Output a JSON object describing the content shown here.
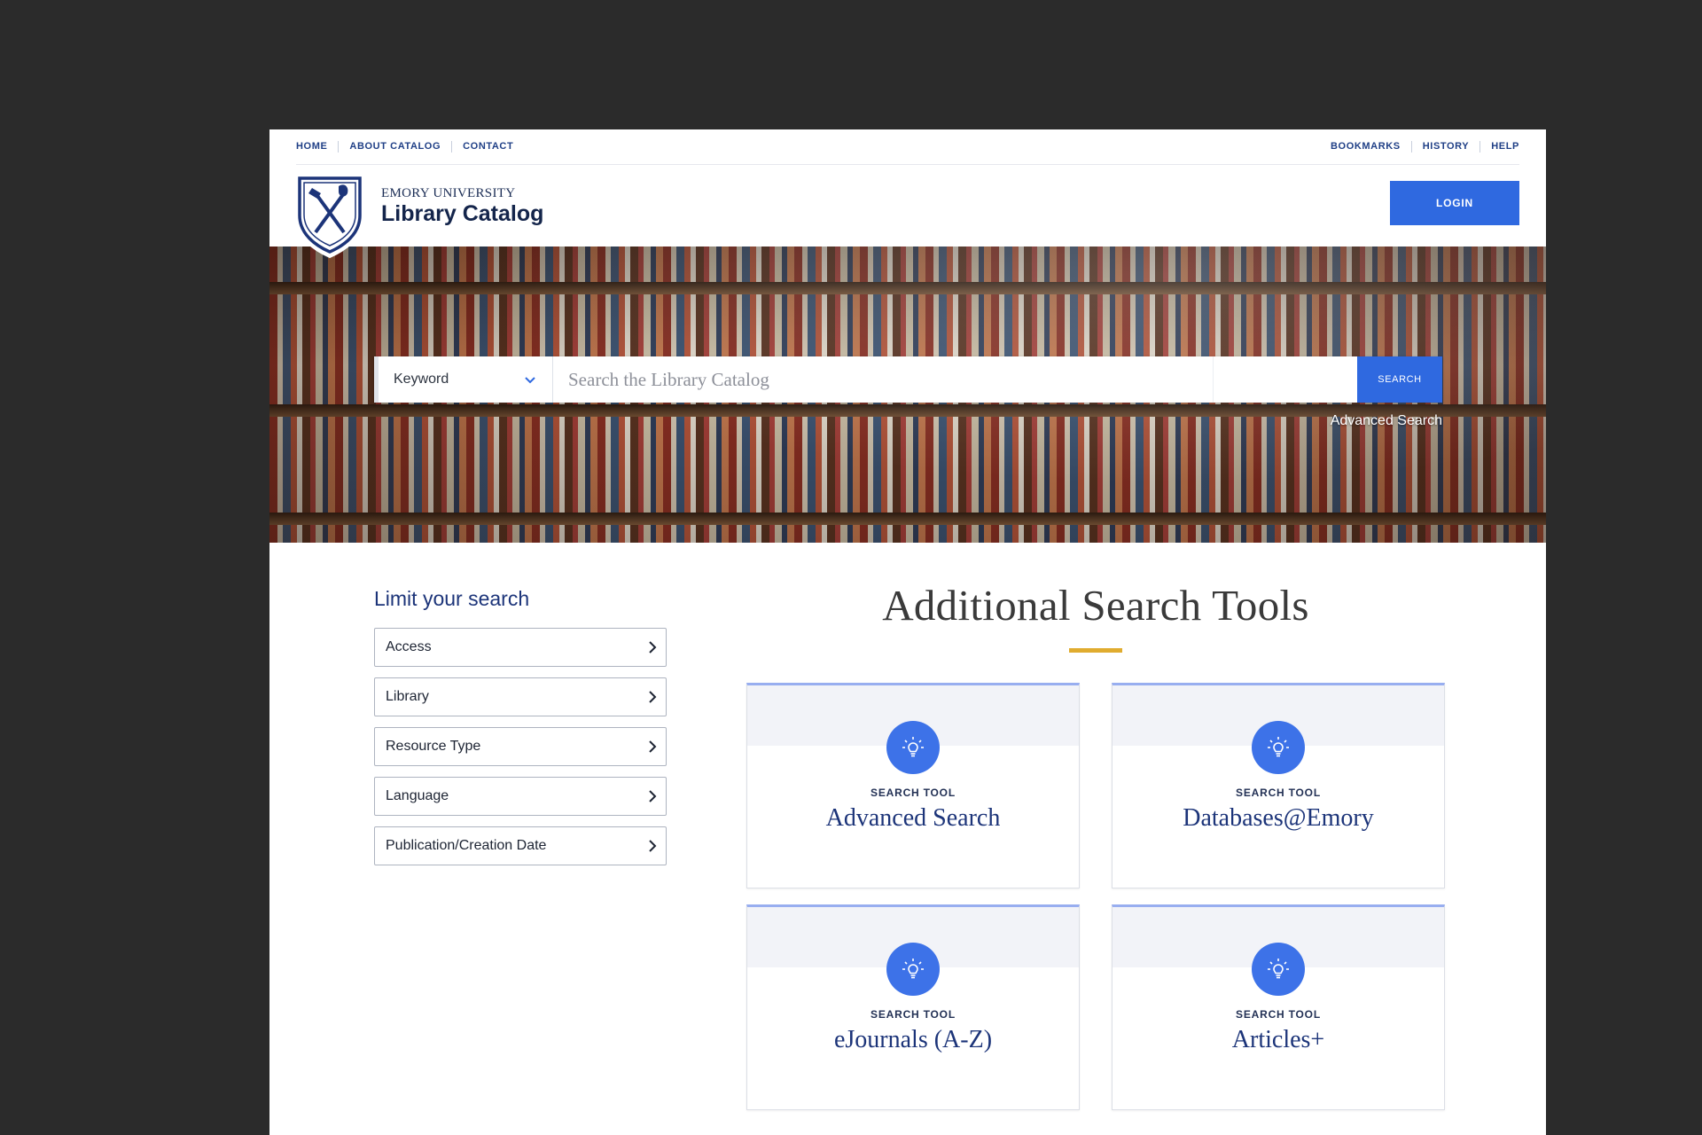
{
  "utility_nav": {
    "left": [
      "HOME",
      "ABOUT CATALOG",
      "CONTACT"
    ],
    "right": [
      "BOOKMARKS",
      "HISTORY",
      "HELP"
    ]
  },
  "header": {
    "brand_small": "EMORY UNIVERSITY",
    "brand_title": "Library Catalog",
    "login_label": "LOGIN",
    "logo_icon": "emory-shield-icon"
  },
  "search": {
    "field_selected": "Keyword",
    "placeholder": "Search the Library Catalog",
    "button_label": "SEARCH",
    "advanced_link": "Advanced Search"
  },
  "limit": {
    "title": "Limit your search",
    "facets": [
      "Access",
      "Library",
      "Resource Type",
      "Language",
      "Publication/Creation Date"
    ]
  },
  "tools": {
    "title": "Additional Search Tools",
    "cards": [
      {
        "kicker": "SEARCH TOOL",
        "name": "Advanced Search"
      },
      {
        "kicker": "SEARCH TOOL",
        "name": "Databases@Emory"
      },
      {
        "kicker": "SEARCH TOOL",
        "name": "eJournals (A-Z)"
      },
      {
        "kicker": "SEARCH TOOL",
        "name": "Articles+"
      }
    ]
  },
  "colors": {
    "primary": "#2f69e0",
    "navy": "#1c3479",
    "accent_gold": "#e0ac2f"
  }
}
